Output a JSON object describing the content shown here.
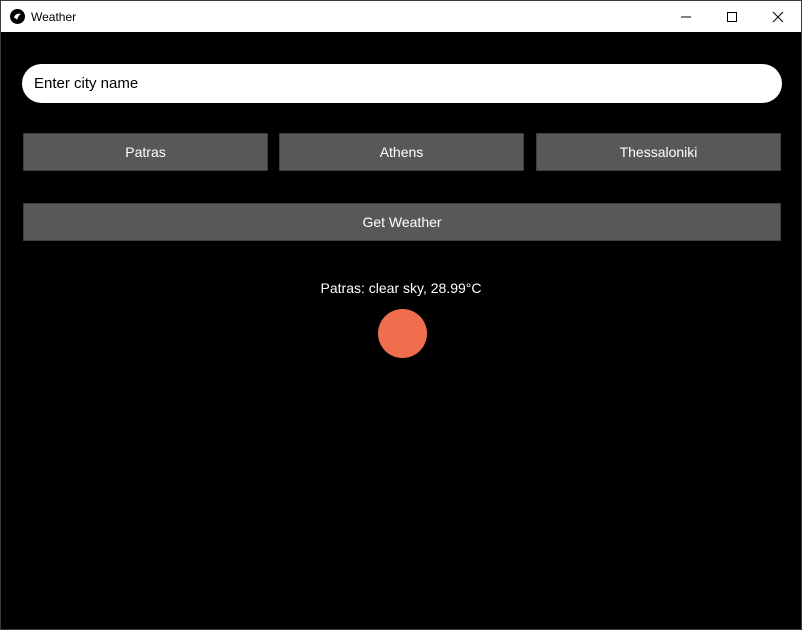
{
  "window": {
    "title": "Weather",
    "app_icon": "kivy-logo-icon",
    "controls": [
      "minimize-icon",
      "maximize-icon",
      "close-icon"
    ]
  },
  "search": {
    "placeholder": "Enter city name",
    "value": ""
  },
  "quick_cities": [
    {
      "label": "Patras"
    },
    {
      "label": "Athens"
    },
    {
      "label": "Thessaloniki"
    }
  ],
  "actions": {
    "get_weather_label": "Get Weather"
  },
  "result": {
    "text": "Patras: clear sky, 28.99°C",
    "icon": "sun-icon",
    "icon_color": "#ee6e4d"
  },
  "colors": {
    "background": "#000000",
    "button": "#585858",
    "text": "#ffffff"
  }
}
